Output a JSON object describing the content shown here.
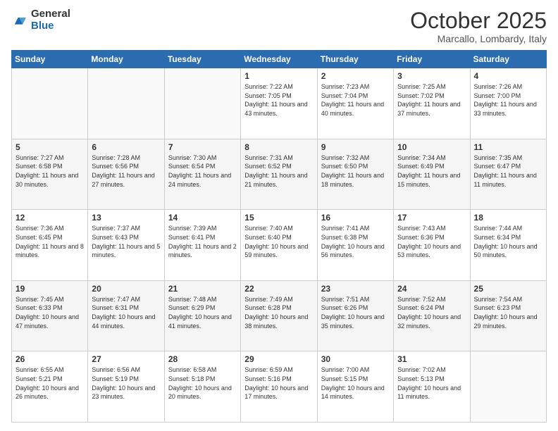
{
  "header": {
    "logo_line1": "General",
    "logo_line2": "Blue",
    "month": "October 2025",
    "location": "Marcallo, Lombardy, Italy"
  },
  "days_of_week": [
    "Sunday",
    "Monday",
    "Tuesday",
    "Wednesday",
    "Thursday",
    "Friday",
    "Saturday"
  ],
  "weeks": [
    [
      {
        "day": "",
        "sunrise": "",
        "sunset": "",
        "daylight": ""
      },
      {
        "day": "",
        "sunrise": "",
        "sunset": "",
        "daylight": ""
      },
      {
        "day": "",
        "sunrise": "",
        "sunset": "",
        "daylight": ""
      },
      {
        "day": "1",
        "sunrise": "Sunrise: 7:22 AM",
        "sunset": "Sunset: 7:05 PM",
        "daylight": "Daylight: 11 hours and 43 minutes."
      },
      {
        "day": "2",
        "sunrise": "Sunrise: 7:23 AM",
        "sunset": "Sunset: 7:04 PM",
        "daylight": "Daylight: 11 hours and 40 minutes."
      },
      {
        "day": "3",
        "sunrise": "Sunrise: 7:25 AM",
        "sunset": "Sunset: 7:02 PM",
        "daylight": "Daylight: 11 hours and 37 minutes."
      },
      {
        "day": "4",
        "sunrise": "Sunrise: 7:26 AM",
        "sunset": "Sunset: 7:00 PM",
        "daylight": "Daylight: 11 hours and 33 minutes."
      }
    ],
    [
      {
        "day": "5",
        "sunrise": "Sunrise: 7:27 AM",
        "sunset": "Sunset: 6:58 PM",
        "daylight": "Daylight: 11 hours and 30 minutes."
      },
      {
        "day": "6",
        "sunrise": "Sunrise: 7:28 AM",
        "sunset": "Sunset: 6:56 PM",
        "daylight": "Daylight: 11 hours and 27 minutes."
      },
      {
        "day": "7",
        "sunrise": "Sunrise: 7:30 AM",
        "sunset": "Sunset: 6:54 PM",
        "daylight": "Daylight: 11 hours and 24 minutes."
      },
      {
        "day": "8",
        "sunrise": "Sunrise: 7:31 AM",
        "sunset": "Sunset: 6:52 PM",
        "daylight": "Daylight: 11 hours and 21 minutes."
      },
      {
        "day": "9",
        "sunrise": "Sunrise: 7:32 AM",
        "sunset": "Sunset: 6:50 PM",
        "daylight": "Daylight: 11 hours and 18 minutes."
      },
      {
        "day": "10",
        "sunrise": "Sunrise: 7:34 AM",
        "sunset": "Sunset: 6:49 PM",
        "daylight": "Daylight: 11 hours and 15 minutes."
      },
      {
        "day": "11",
        "sunrise": "Sunrise: 7:35 AM",
        "sunset": "Sunset: 6:47 PM",
        "daylight": "Daylight: 11 hours and 11 minutes."
      }
    ],
    [
      {
        "day": "12",
        "sunrise": "Sunrise: 7:36 AM",
        "sunset": "Sunset: 6:45 PM",
        "daylight": "Daylight: 11 hours and 8 minutes."
      },
      {
        "day": "13",
        "sunrise": "Sunrise: 7:37 AM",
        "sunset": "Sunset: 6:43 PM",
        "daylight": "Daylight: 11 hours and 5 minutes."
      },
      {
        "day": "14",
        "sunrise": "Sunrise: 7:39 AM",
        "sunset": "Sunset: 6:41 PM",
        "daylight": "Daylight: 11 hours and 2 minutes."
      },
      {
        "day": "15",
        "sunrise": "Sunrise: 7:40 AM",
        "sunset": "Sunset: 6:40 PM",
        "daylight": "Daylight: 10 hours and 59 minutes."
      },
      {
        "day": "16",
        "sunrise": "Sunrise: 7:41 AM",
        "sunset": "Sunset: 6:38 PM",
        "daylight": "Daylight: 10 hours and 56 minutes."
      },
      {
        "day": "17",
        "sunrise": "Sunrise: 7:43 AM",
        "sunset": "Sunset: 6:36 PM",
        "daylight": "Daylight: 10 hours and 53 minutes."
      },
      {
        "day": "18",
        "sunrise": "Sunrise: 7:44 AM",
        "sunset": "Sunset: 6:34 PM",
        "daylight": "Daylight: 10 hours and 50 minutes."
      }
    ],
    [
      {
        "day": "19",
        "sunrise": "Sunrise: 7:45 AM",
        "sunset": "Sunset: 6:33 PM",
        "daylight": "Daylight: 10 hours and 47 minutes."
      },
      {
        "day": "20",
        "sunrise": "Sunrise: 7:47 AM",
        "sunset": "Sunset: 6:31 PM",
        "daylight": "Daylight: 10 hours and 44 minutes."
      },
      {
        "day": "21",
        "sunrise": "Sunrise: 7:48 AM",
        "sunset": "Sunset: 6:29 PM",
        "daylight": "Daylight: 10 hours and 41 minutes."
      },
      {
        "day": "22",
        "sunrise": "Sunrise: 7:49 AM",
        "sunset": "Sunset: 6:28 PM",
        "daylight": "Daylight: 10 hours and 38 minutes."
      },
      {
        "day": "23",
        "sunrise": "Sunrise: 7:51 AM",
        "sunset": "Sunset: 6:26 PM",
        "daylight": "Daylight: 10 hours and 35 minutes."
      },
      {
        "day": "24",
        "sunrise": "Sunrise: 7:52 AM",
        "sunset": "Sunset: 6:24 PM",
        "daylight": "Daylight: 10 hours and 32 minutes."
      },
      {
        "day": "25",
        "sunrise": "Sunrise: 7:54 AM",
        "sunset": "Sunset: 6:23 PM",
        "daylight": "Daylight: 10 hours and 29 minutes."
      }
    ],
    [
      {
        "day": "26",
        "sunrise": "Sunrise: 6:55 AM",
        "sunset": "Sunset: 5:21 PM",
        "daylight": "Daylight: 10 hours and 26 minutes."
      },
      {
        "day": "27",
        "sunrise": "Sunrise: 6:56 AM",
        "sunset": "Sunset: 5:19 PM",
        "daylight": "Daylight: 10 hours and 23 minutes."
      },
      {
        "day": "28",
        "sunrise": "Sunrise: 6:58 AM",
        "sunset": "Sunset: 5:18 PM",
        "daylight": "Daylight: 10 hours and 20 minutes."
      },
      {
        "day": "29",
        "sunrise": "Sunrise: 6:59 AM",
        "sunset": "Sunset: 5:16 PM",
        "daylight": "Daylight: 10 hours and 17 minutes."
      },
      {
        "day": "30",
        "sunrise": "Sunrise: 7:00 AM",
        "sunset": "Sunset: 5:15 PM",
        "daylight": "Daylight: 10 hours and 14 minutes."
      },
      {
        "day": "31",
        "sunrise": "Sunrise: 7:02 AM",
        "sunset": "Sunset: 5:13 PM",
        "daylight": "Daylight: 10 hours and 11 minutes."
      },
      {
        "day": "",
        "sunrise": "",
        "sunset": "",
        "daylight": ""
      }
    ]
  ]
}
